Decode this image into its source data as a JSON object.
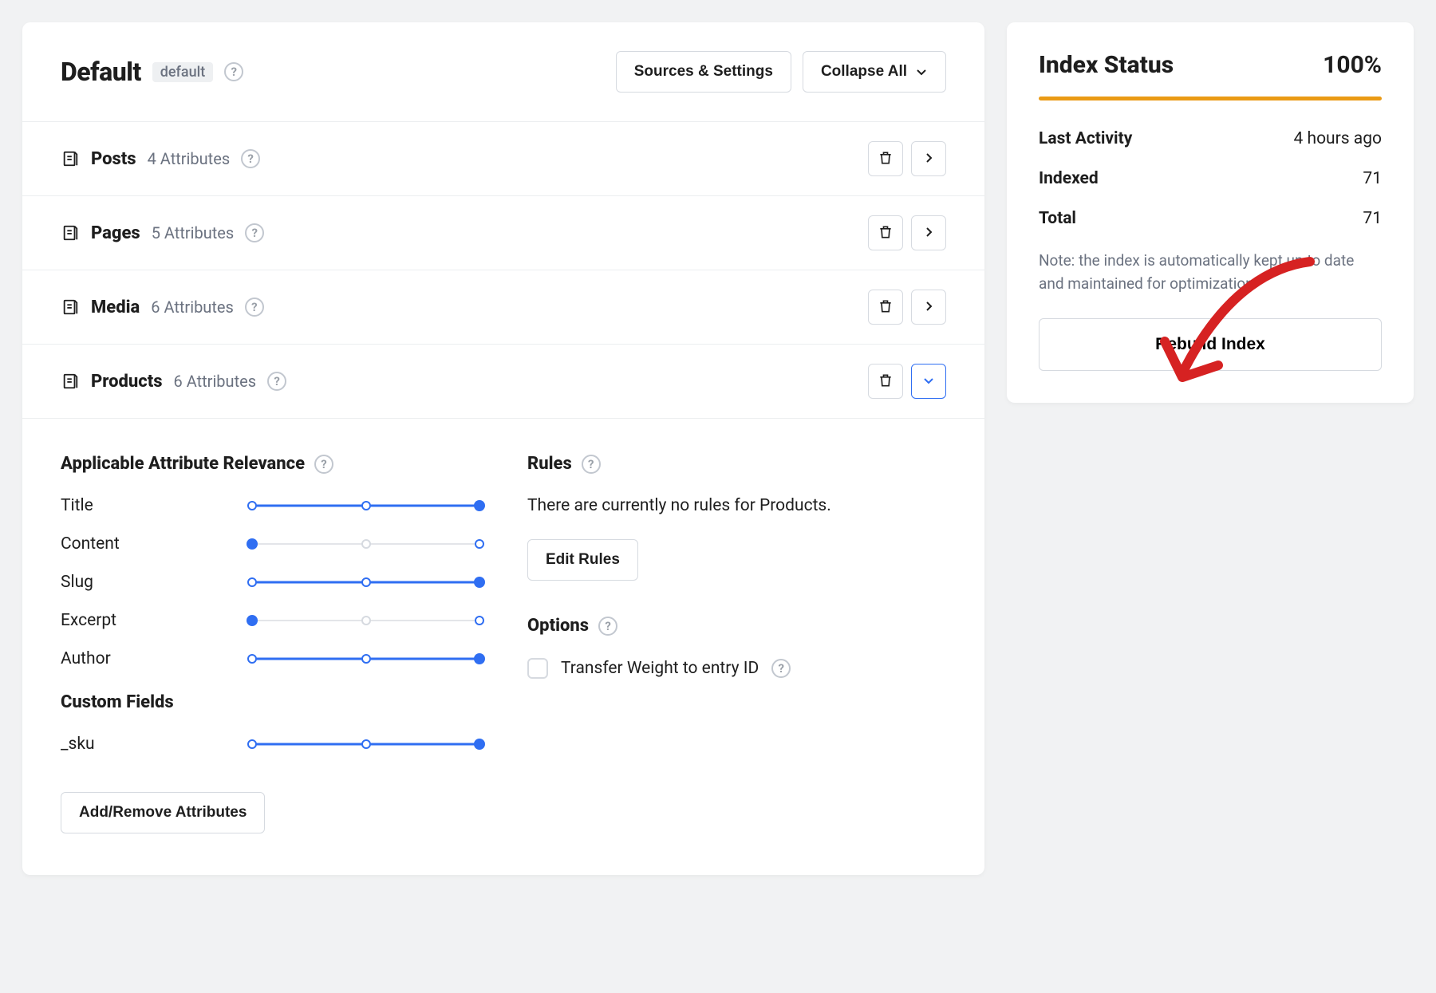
{
  "header": {
    "title": "Default",
    "tag": "default",
    "sources_btn": "Sources & Settings",
    "collapse_btn": "Collapse All"
  },
  "post_types": [
    {
      "name": "Posts",
      "meta": "4 Attributes",
      "expanded": false
    },
    {
      "name": "Pages",
      "meta": "5 Attributes",
      "expanded": false
    },
    {
      "name": "Media",
      "meta": "6 Attributes",
      "expanded": false
    },
    {
      "name": "Products",
      "meta": "6 Attributes",
      "expanded": true
    }
  ],
  "relevance": {
    "heading": "Applicable Attribute Relevance",
    "rows": [
      {
        "label": "Title",
        "fill_from": 0,
        "fill_to": 100,
        "knob": 100,
        "mid_tick_on": true
      },
      {
        "label": "Content",
        "fill_from": 0,
        "fill_to": 0,
        "knob": 0,
        "mid_tick_on": false
      },
      {
        "label": "Slug",
        "fill_from": 0,
        "fill_to": 100,
        "knob": 100,
        "mid_tick_on": true
      },
      {
        "label": "Excerpt",
        "fill_from": 0,
        "fill_to": 0,
        "knob": 0,
        "mid_tick_on": false
      },
      {
        "label": "Author",
        "fill_from": 0,
        "fill_to": 100,
        "knob": 100,
        "mid_tick_on": true
      }
    ],
    "custom_heading": "Custom Fields",
    "custom_rows": [
      {
        "label": "_sku",
        "fill_from": 0,
        "fill_to": 100,
        "knob": 100,
        "mid_tick_on": true
      }
    ],
    "add_remove_btn": "Add/Remove Attributes"
  },
  "rules": {
    "heading": "Rules",
    "empty_text": "There are currently no rules for Products.",
    "edit_btn": "Edit Rules"
  },
  "options": {
    "heading": "Options",
    "transfer_label": "Transfer Weight to entry ID"
  },
  "status": {
    "title": "Index Status",
    "percent": "100%",
    "rows": [
      {
        "k": "Last Activity",
        "v": "4 hours ago"
      },
      {
        "k": "Indexed",
        "v": "71"
      },
      {
        "k": "Total",
        "v": "71"
      }
    ],
    "note": "Note: the index is automatically kept up to date and maintained for optimization",
    "rebuild_btn": "Rebuild Index"
  }
}
